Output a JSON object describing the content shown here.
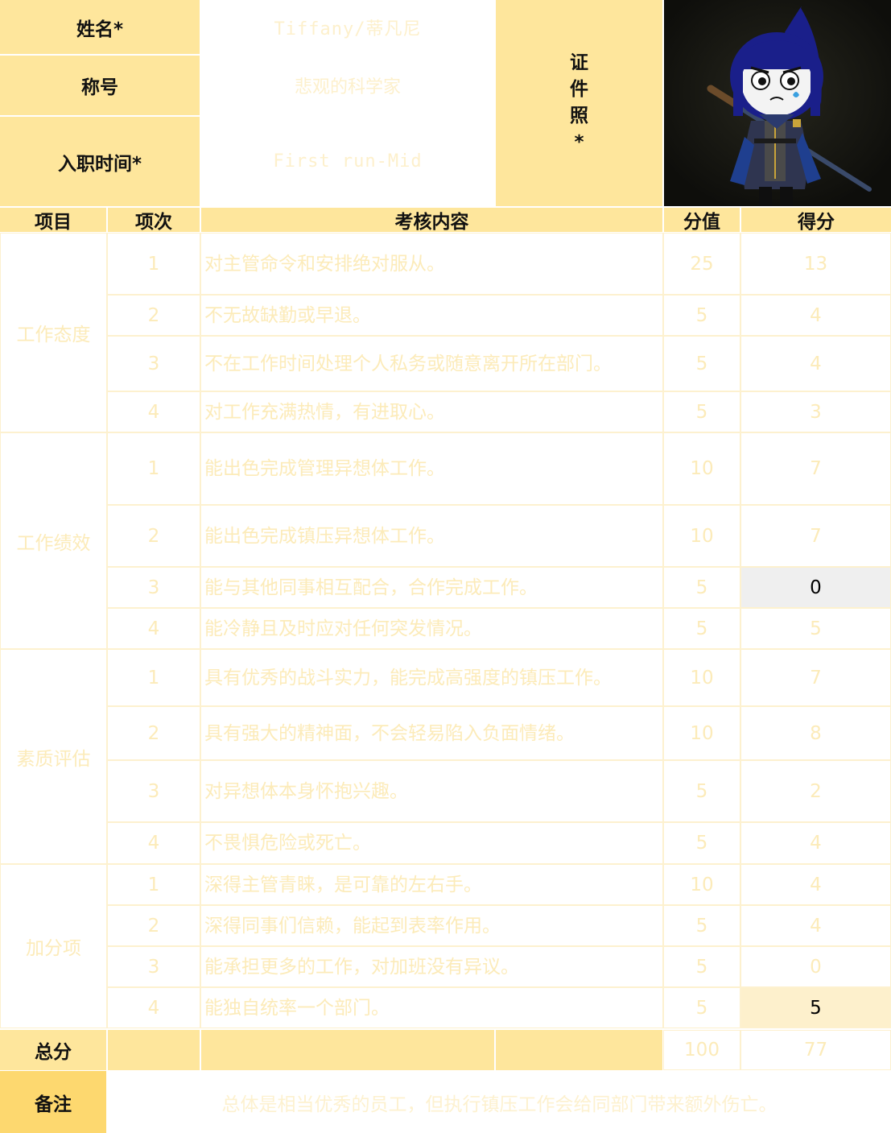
{
  "header": {
    "name_label": "姓名*",
    "name_value": "Tiffany/蒂凡尼",
    "title_label": "称号",
    "title_value": "悲观的科学家",
    "hire_label": "入职时间*",
    "hire_value": "First run-Mid",
    "photo_label": [
      "证",
      "件",
      "照",
      "*"
    ]
  },
  "columns": {
    "category": "项目",
    "index": "项次",
    "content": "考核内容",
    "points": "分值",
    "score": "得分"
  },
  "sections": [
    {
      "category": "工作态度",
      "rows": [
        {
          "index": "1",
          "content": "对主管命令和安排绝对服从。",
          "points": "25",
          "score": "13"
        },
        {
          "index": "2",
          "content": "不无故缺勤或早退。",
          "points": "5",
          "score": "4"
        },
        {
          "index": "3",
          "content": "不在工作时间处理个人私务或随意离开所在部门。",
          "points": "5",
          "score": "4"
        },
        {
          "index": "4",
          "content": "对工作充满热情，有进取心。",
          "points": "5",
          "score": "3"
        }
      ]
    },
    {
      "category": "工作绩效",
      "rows": [
        {
          "index": "1",
          "content": "能出色完成管理异想体工作。",
          "points": "10",
          "score": "7"
        },
        {
          "index": "2",
          "content": "能出色完成镇压异想体工作。",
          "points": "10",
          "score": "7"
        },
        {
          "index": "3",
          "content": "能与其他同事相互配合，合作完成工作。",
          "points": "5",
          "score": "0"
        },
        {
          "index": "4",
          "content": "能冷静且及时应对任何突发情况。",
          "points": "5",
          "score": "5"
        }
      ]
    },
    {
      "category": "素质评估",
      "rows": [
        {
          "index": "1",
          "content": "具有优秀的战斗实力，能完成高强度的镇压工作。",
          "points": "10",
          "score": "7"
        },
        {
          "index": "2",
          "content": "具有强大的精神面，不会轻易陷入负面情绪。",
          "points": "10",
          "score": "8"
        },
        {
          "index": "3",
          "content": "对异想体本身怀抱兴趣。",
          "points": "5",
          "score": "2"
        },
        {
          "index": "4",
          "content": "不畏惧危险或死亡。",
          "points": "5",
          "score": "4"
        }
      ]
    },
    {
      "category": "加分项",
      "rows": [
        {
          "index": "1",
          "content": "深得主管青睐，是可靠的左右手。",
          "points": "10",
          "score": "4"
        },
        {
          "index": "2",
          "content": "深得同事们信赖，能起到表率作用。",
          "points": "5",
          "score": "4"
        },
        {
          "index": "3",
          "content": "能承担更多的工作，对加班没有异议。",
          "points": "5",
          "score": "0"
        },
        {
          "index": "4",
          "content": "能独自统率一个部门。",
          "points": "5",
          "score": "5"
        }
      ]
    }
  ],
  "total": {
    "label": "总分",
    "points": "100",
    "score": "77"
  },
  "remark": {
    "label": "备注",
    "text": "总体是相当优秀的员工，但执行镇压工作会给同部门带来额外伤亡。"
  },
  "colors": {
    "header": "#fee69c",
    "remark_label": "#fdd86f",
    "faint_text": "#fcebb9"
  }
}
